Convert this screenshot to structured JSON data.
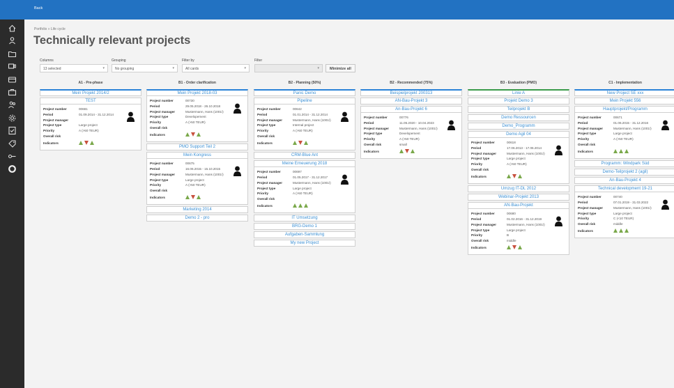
{
  "topbar": {
    "back_label": "Back"
  },
  "sidebar": {
    "items": [
      "home-icon",
      "user-icon",
      "folder-icon",
      "monitor-icon",
      "card-icon",
      "briefcase-icon",
      "users-icon",
      "gear-icon",
      "checklist-icon",
      "tag-icon",
      "key-icon",
      "circle-icon"
    ]
  },
  "breadcrumb": "Portfolio  »  Life cycle",
  "page_title": "Technically relevant projects",
  "filters": {
    "columns": {
      "label": "Columns",
      "value": "13 selected"
    },
    "grouping": {
      "label": "Grouping",
      "value": "No grouping"
    },
    "filter_by": {
      "label": "Filter by",
      "value": "All cards"
    },
    "filter": {
      "label": "Filter",
      "value": ""
    },
    "minimize_label": "Minimize all"
  },
  "field_labels": {
    "project_number": "Project number",
    "period": "Period",
    "project_manager": "Project manager",
    "project_type": "Project type",
    "priority": "Priority",
    "overall_risk": "Overall risk",
    "indicators": "Indicators"
  },
  "colors": {
    "accent": "#2272c2",
    "link": "#3a8fd4",
    "up": "#7aa84a",
    "down": "#c8513e",
    "sidebar": "#2b2b2b"
  },
  "columns": [
    {
      "title": "A1 - Pre-phase",
      "cards": [
        {
          "title": "Mein Projekt 2014/2"
        },
        {
          "title": "TEST",
          "details": {
            "project_number": "00681",
            "period": "01.09.2014 - 31.12.2014",
            "project_manager": "",
            "project_type": "Large project",
            "priority": "A (>50 TEUR)",
            "overall_risk": "",
            "indicators": [
              "up",
              "down",
              "up"
            ]
          }
        }
      ]
    },
    {
      "title": "B1 - Order clarification",
      "cards": [
        {
          "title": "Mein Projekt 2018-03",
          "details": {
            "project_number": "00730",
            "period": "29.05.2018 - 26.10.2018",
            "project_manager": "Mustermann, Hans (1001/)",
            "project_type": "Developement",
            "priority": "A (>50 TEUR)",
            "overall_risk": "",
            "indicators": [
              "up",
              "down",
              "up"
            ]
          }
        },
        {
          "title": "PMO Support Teil 2"
        },
        {
          "title": "Mein Kongress",
          "details": {
            "project_number": "00675",
            "period": "16.06.2015 - 15.10.2015",
            "project_manager": "Mustermann, Hans (1001/)",
            "project_type": "Large project",
            "priority": "A (>50 TEUR)",
            "overall_risk": "",
            "indicators": [
              "up",
              "down",
              "up"
            ]
          }
        },
        {
          "title": "Marketing 2014"
        },
        {
          "title": "Demo 2 - pro"
        }
      ]
    },
    {
      "title": "B2 - Planning (50%)",
      "cards": [
        {
          "title": "Panic Demo"
        },
        {
          "title": "Pipeline",
          "details": {
            "project_number": "00642",
            "period": "01.01.2014 - 31.12.2014",
            "project_manager": "Mustermann, Hans (1001/)",
            "project_type": "Internal project",
            "priority": "A (>50 TEUR)",
            "overall_risk": "",
            "indicators": [
              "up",
              "down",
              "up"
            ]
          }
        },
        {
          "title": "CRM-Blue Ant"
        },
        {
          "title": "Meine Erneuerung 2018",
          "details": {
            "project_number": "00697",
            "period": "01.05.2017 - 31.12.2017",
            "project_manager": "Mustermann, Hans (1001/)",
            "project_type": "Large project",
            "priority": "A (>50 TEUR)",
            "overall_risk": "",
            "indicators": [
              "up",
              "up",
              "up"
            ]
          }
        },
        {
          "title": "IT Umsetzung"
        },
        {
          "title": "BRG-Demo 1"
        },
        {
          "title": "Aufgaben-Sammlung"
        },
        {
          "title": "My new Project"
        }
      ]
    },
    {
      "title": "B2 - Recommended (75%)",
      "cards": [
        {
          "title": "Beispielprojekt 200313"
        },
        {
          "title": "AN-Bau-Projekt 3"
        },
        {
          "title": "An-Bau-Projekt 6",
          "details": {
            "project_number": "00776",
            "period": "11.05.2020 - 10.04.2023",
            "project_manager": "Mustermann, Hans (1001/)",
            "project_type": "Developement",
            "priority": "A (>50 TEUR)",
            "overall_risk": "small",
            "indicators": [
              "up",
              "down",
              "up"
            ]
          }
        }
      ]
    },
    {
      "title": "B3 - Evaluation (PMO)",
      "cards": [
        {
          "title": "Linie A"
        },
        {
          "title": "Projekt Demo 3"
        },
        {
          "title": "Teilprojekt B"
        },
        {
          "title": "Demo Ressourcen"
        },
        {
          "title": "Demo_Programm"
        },
        {
          "title": "Demo Agil 04",
          "details": {
            "project_number": "00618",
            "period": "17.06.2013 - 17.06.2014",
            "project_manager": "Mustermann, Hans (1001/)",
            "project_type": "Large project",
            "priority": "A (>50 TEUR)",
            "overall_risk": "",
            "indicators": [
              "up",
              "down",
              "up"
            ]
          }
        },
        {
          "title": "Umzug IT-DL 2012"
        },
        {
          "title": "Webinar-Projekt 2013"
        },
        {
          "title": "AN-Bau-Projekt",
          "details": {
            "project_number": "00680",
            "period": "01.02.2016 - 31.12.2019",
            "project_manager": "Mustermann, Hans (1001/)",
            "project_type": "Large project",
            "priority": "B",
            "overall_risk": "middle",
            "indicators": [
              "up",
              "down",
              "up"
            ]
          }
        }
      ]
    },
    {
      "title": "C1 - Implementation",
      "cards": [
        {
          "title": "New Project SE xxx"
        },
        {
          "title": "Mein Projekt 556"
        },
        {
          "title": "Hauptprojekt/Programm",
          "details": {
            "project_number": "00671",
            "period": "01.06.2015 - 31.12.2016",
            "project_manager": "Mustermann, Hans (1001/)",
            "project_type": "Large project",
            "priority": "A (>50 TEUR)",
            "overall_risk": "",
            "indicators": [
              "up",
              "up",
              "up"
            ]
          }
        },
        {
          "title": "Programm: Windpark Süd"
        },
        {
          "title": "Demo-Teilprojekt 2 (agil)"
        },
        {
          "title": "An-Bau-Projekt 4"
        },
        {
          "title": "Technical development 19-21",
          "details": {
            "project_number": "00740",
            "period": "07.01.2019 - 31.03.2022",
            "project_manager": "Mustermann, Hans (1001/)",
            "project_type": "Large project",
            "priority": "C (<10 TEUR)",
            "overall_risk": "middle",
            "indicators": [
              "up",
              "up",
              "up"
            ]
          }
        }
      ]
    }
  ]
}
